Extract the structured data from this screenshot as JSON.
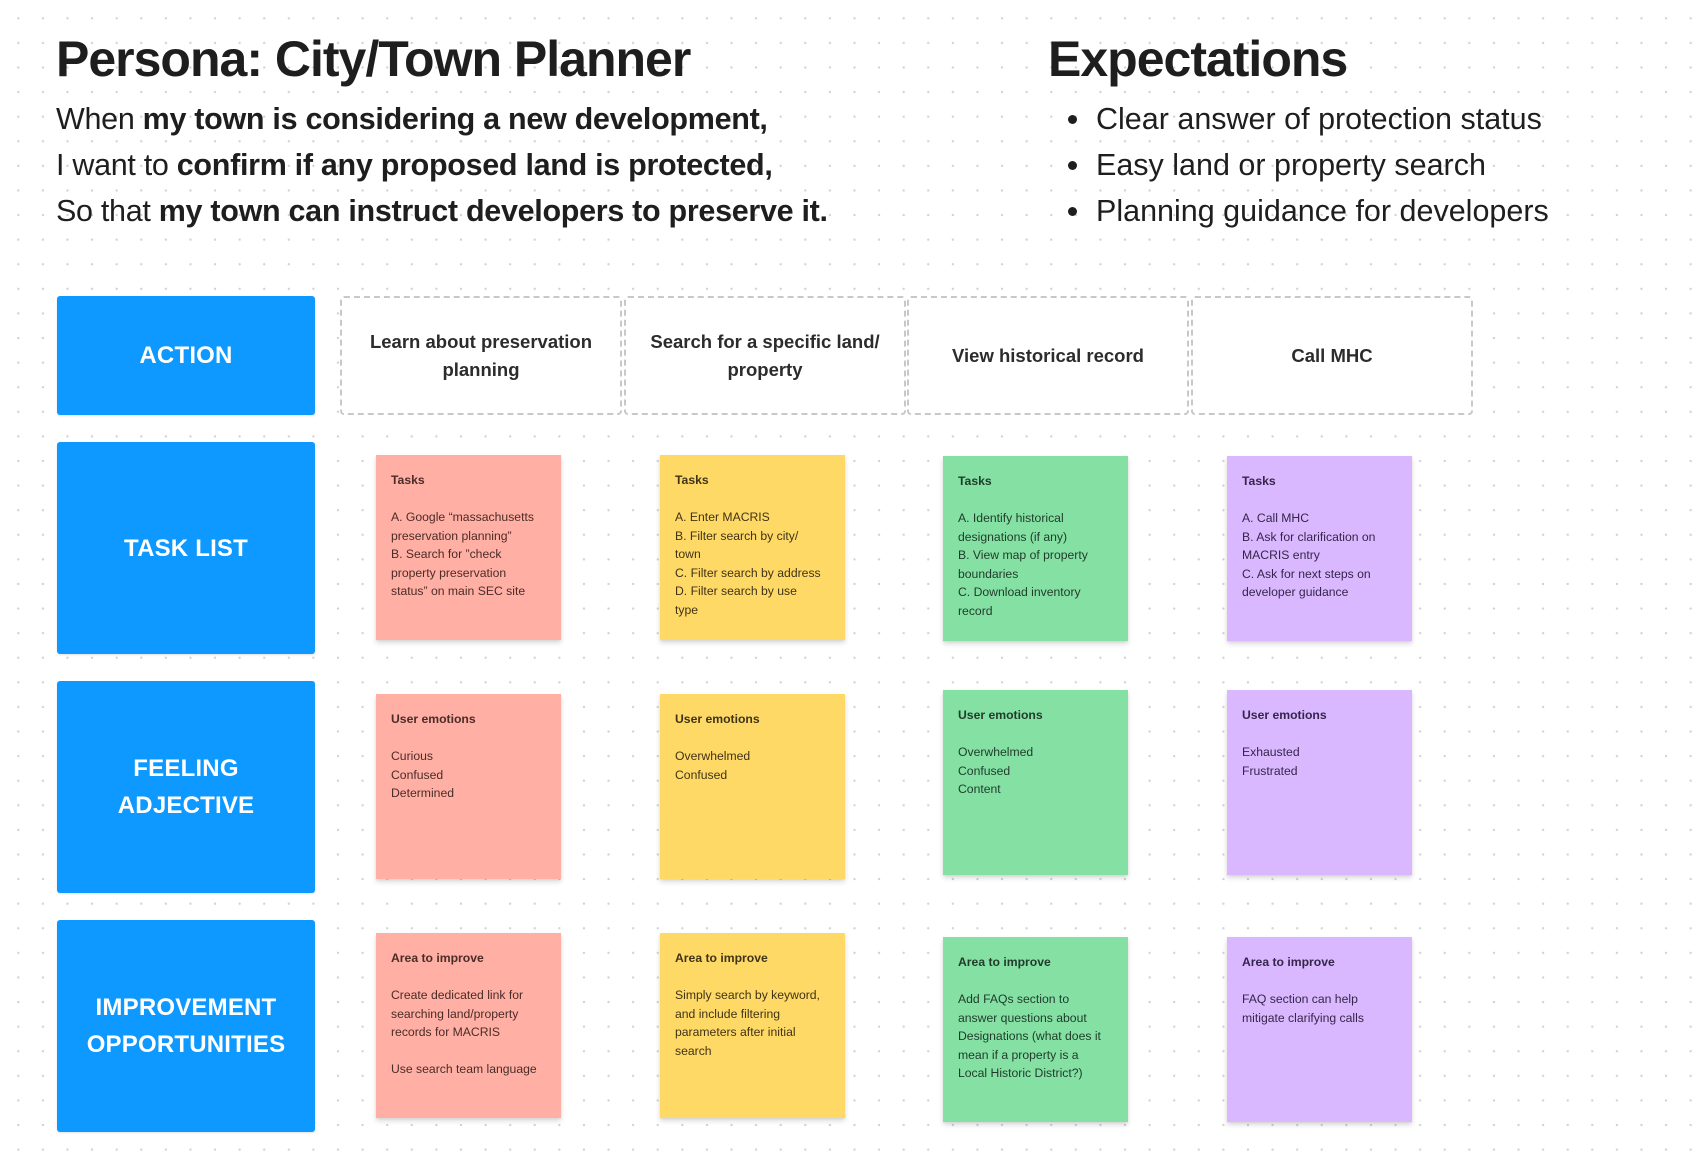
{
  "persona": {
    "title": "Persona: City/Town Planner",
    "story": [
      {
        "plain": "When ",
        "bold": "my town is considering a new development,"
      },
      {
        "plain": "I want to ",
        "bold": "confirm if any proposed land is protected,"
      },
      {
        "plain": "So that ",
        "bold": "my town can instruct developers to preserve it."
      }
    ]
  },
  "expectations": {
    "title": "Expectations",
    "items": [
      "Clear answer of protection status",
      "Easy land or property search",
      "Planning guidance for developers"
    ]
  },
  "row_labels": {
    "action": "ACTION",
    "task_list": "TASK LIST",
    "feeling": [
      "FEELING",
      "ADJECTIVE"
    ],
    "improvement": [
      "IMPROVEMENT",
      "OPPORTUNITIES"
    ]
  },
  "colors": {
    "row_label_blue": "#0d99ff",
    "sticky_red": "#ffafa3",
    "sticky_yellow": "#ffd966",
    "sticky_green": "#85e0a3",
    "sticky_purple": "#d9b8ff"
  },
  "columns": [
    {
      "action": "Learn about preservation planning",
      "tasks": {
        "heading": "Tasks",
        "lines": [
          "A. Google “massachusetts",
          "preservation planning”",
          "B. Search for ”check",
          "property preservation",
          "status” on main SEC site"
        ]
      },
      "emotions": {
        "heading": "User emotions",
        "lines": [
          "Curious",
          "Confused",
          "Determined"
        ]
      },
      "improve": {
        "heading": "Area to improve",
        "lines": [
          "Create dedicated link for",
          "searching land/property",
          "records for MACRIS",
          "",
          "Use search team language"
        ]
      }
    },
    {
      "action": "Search for a specific land/ property",
      "tasks": {
        "heading": "Tasks",
        "lines": [
          "A. Enter MACRIS",
          "B. Filter search by city/",
          "town",
          "C. Filter search by address",
          "D. Filter search by use",
          "type"
        ]
      },
      "emotions": {
        "heading": "User emotions",
        "lines": [
          "Overwhelmed",
          "Confused"
        ]
      },
      "improve": {
        "heading": "Area to improve",
        "lines": [
          "Simply search by keyword,",
          "and include filtering",
          "parameters after initial",
          "search"
        ]
      }
    },
    {
      "action": "View historical record",
      "tasks": {
        "heading": "Tasks",
        "lines": [
          "A. Identify historical",
          "designations (if any)",
          "B. View map of property",
          "boundaries",
          "C. Download inventory",
          "record"
        ]
      },
      "emotions": {
        "heading": "User emotions",
        "lines": [
          "Overwhelmed",
          "Confused",
          "Content"
        ]
      },
      "improve": {
        "heading": "Area to improve",
        "lines": [
          "Add FAQs section to",
          "answer questions about",
          "Designations (what does it",
          "mean if a property is a",
          "Local Historic District?)"
        ]
      }
    },
    {
      "action": "Call MHC",
      "tasks": {
        "heading": "Tasks",
        "lines": [
          "A. Call MHC",
          "B. Ask for clarification on",
          "MACRIS entry",
          "C. Ask for next steps on",
          "developer guidance"
        ]
      },
      "emotions": {
        "heading": "User emotions",
        "lines": [
          "Exhausted",
          "Frustrated"
        ]
      },
      "improve": {
        "heading": "Area to improve",
        "lines": [
          "FAQ section can help",
          "mitigate clarifying calls"
        ]
      }
    }
  ]
}
